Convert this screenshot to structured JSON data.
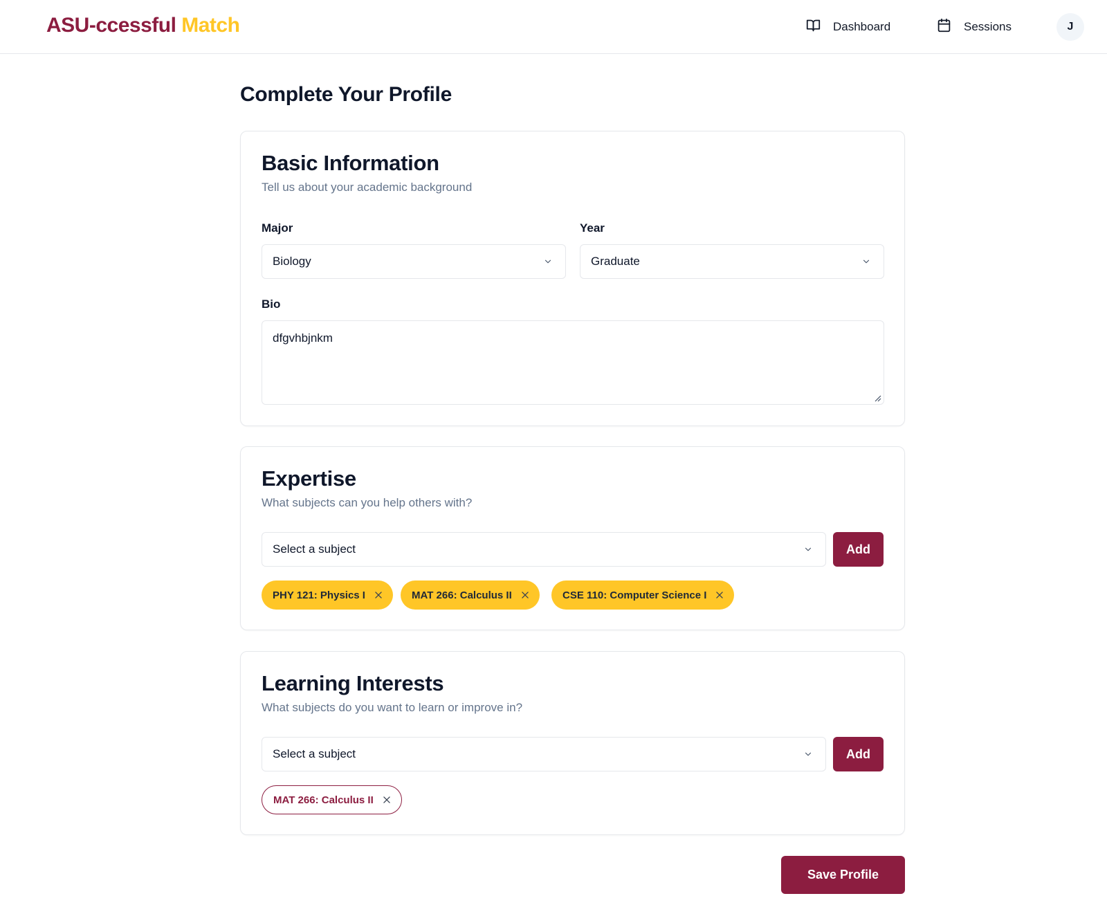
{
  "brand": {
    "part1": "ASU-ccessful",
    "part2": "Match"
  },
  "nav": {
    "dashboard": {
      "label": "Dashboard",
      "icon": "book-open-icon"
    },
    "sessions": {
      "label": "Sessions",
      "icon": "calendar-icon"
    },
    "avatar_initial": "J"
  },
  "page": {
    "title": "Complete Your Profile"
  },
  "basic": {
    "title": "Basic Information",
    "description": "Tell us about your academic background",
    "major_label": "Major",
    "major_value": "Biology",
    "year_label": "Year",
    "year_value": "Graduate",
    "bio_label": "Bio",
    "bio_value": "dfgvhbjnkm"
  },
  "expertise": {
    "title": "Expertise",
    "description": "What subjects can you help others with?",
    "select_placeholder": "Select a subject",
    "add_label": "Add",
    "chips": [
      "PHY 121: Physics I",
      "MAT 266: Calculus II",
      "CSE 110: Computer Science I"
    ]
  },
  "learning": {
    "title": "Learning Interests",
    "description": "What subjects do you want to learn or improve in?",
    "select_placeholder": "Select a subject",
    "add_label": "Add",
    "chips": [
      "MAT 266: Calculus II"
    ]
  },
  "actions": {
    "save_label": "Save Profile"
  },
  "colors": {
    "maroon": "#8c1d40",
    "gold": "#ffc627",
    "muted": "#64748b",
    "border": "#e5e7eb"
  }
}
